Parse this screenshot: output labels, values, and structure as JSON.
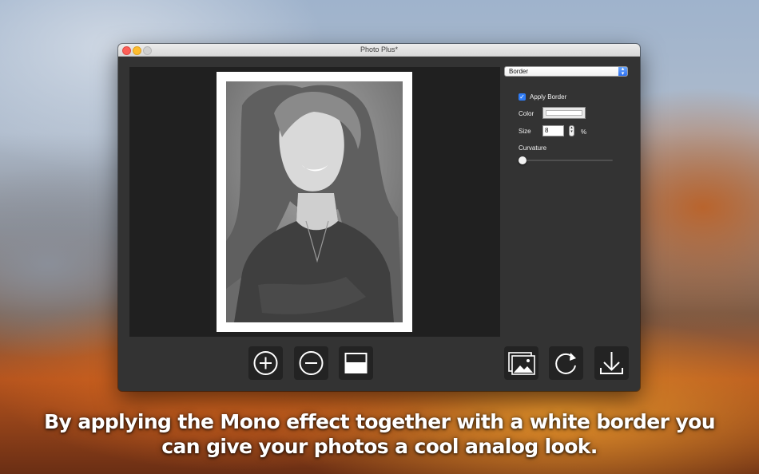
{
  "window": {
    "title": "Photo Plus*"
  },
  "panel": {
    "effect_dropdown": "Border",
    "apply_border": {
      "label": "Apply Border",
      "checked": true
    },
    "color_label": "Color",
    "border_color": "#ffffff",
    "size_label": "Size",
    "size_value": "8",
    "size_unit": "%",
    "curvature_label": "Curvature",
    "curvature_value": 0
  },
  "toolbar": {
    "left": [
      {
        "name": "zoom-in-icon"
      },
      {
        "name": "zoom-out-icon"
      },
      {
        "name": "split-view-icon"
      }
    ],
    "right": [
      {
        "name": "open-image-icon"
      },
      {
        "name": "rotate-icon"
      },
      {
        "name": "export-icon"
      }
    ]
  },
  "caption": {
    "line1": "By applying the Mono effect together with a white border you",
    "line2": "can give your photos a cool analog look."
  }
}
